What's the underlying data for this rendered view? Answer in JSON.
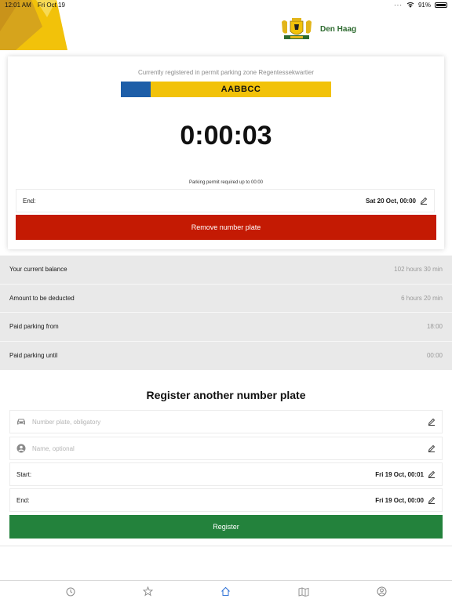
{
  "status_bar": {
    "time": "12:01 AM",
    "date": "Fri Oct 19",
    "battery": "91%"
  },
  "header": {
    "brand": "Den Haag"
  },
  "colors": {
    "accent_yellow": "#f2c20a",
    "eu_blue": "#1d5ea8",
    "remove_red": "#c41a03",
    "register_green": "#23823c",
    "brand_green": "#2e6b30"
  },
  "parking": {
    "zone_text": "Currently registered in permit parking zone Regentessekwartier",
    "plate": "AABBCC",
    "timer": "0:00:03",
    "permit_note": "Parking permit required up to 00:00",
    "end_label": "End:",
    "end_value": "Sat 20 Oct, 00:00",
    "remove_button": "Remove number plate"
  },
  "summary": [
    {
      "label": "Your current balance",
      "value": "102 hours 30 min"
    },
    {
      "label": "Amount to be deducted",
      "value": "6 hours 20 min"
    },
    {
      "label": "Paid parking from",
      "value": "18:00"
    },
    {
      "label": "Paid parking until",
      "value": "00:00"
    }
  ],
  "register": {
    "title": "Register another number plate",
    "plate_placeholder": "Number plate, obligatory",
    "name_placeholder": "Name, optional",
    "start_label": "Start:",
    "start_value": "Fri 19 Oct, 00:01",
    "end_label": "End:",
    "end_value": "Fri 19 Oct, 00:00",
    "button": "Register"
  },
  "tabs": [
    {
      "icon": "clock-icon"
    },
    {
      "icon": "star-icon"
    },
    {
      "icon": "home-icon",
      "active": true
    },
    {
      "icon": "map-icon"
    },
    {
      "icon": "account-icon"
    }
  ]
}
